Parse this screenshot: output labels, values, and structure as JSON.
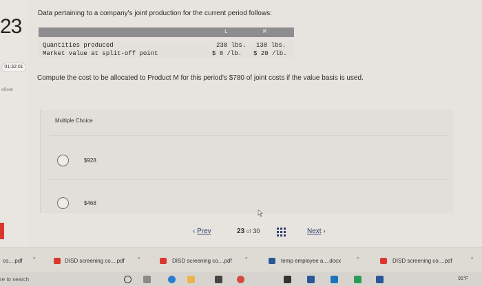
{
  "question": {
    "number": "23",
    "timer": "01:32:01",
    "ebook_label": "eBook",
    "prompt": "Data pertaining to a company's joint production for the current period follows:",
    "table": {
      "headers": [
        "L",
        "M"
      ],
      "rows": [
        {
          "label": "Quantities produced",
          "L": "230 lbs.",
          "M": "138 lbs."
        },
        {
          "label": "Market value at split-off point",
          "L": "$  8 /lb.",
          "M": "$ 20 /lb."
        }
      ]
    },
    "text": "Compute the cost to be allocated to Product M for this period's $780 of joint costs if the value basis is used."
  },
  "multiple_choice": {
    "label": "Multiple Choice",
    "options": [
      "$928",
      "$468"
    ]
  },
  "nav": {
    "prev": "Prev",
    "current": "23",
    "of": "of",
    "total": "30",
    "next": "Next"
  },
  "downloads": {
    "items": [
      "co....pdf",
      "DISD screening co....pdf",
      "DISD screening co....pdf",
      "temp employee a....docx",
      "DISD screening co....pdf"
    ]
  },
  "taskbar": {
    "search_text": "re to search",
    "temperature": "91°F"
  },
  "colors": {
    "accent": "#2c3e6b",
    "pdf_icon": "#d9382f",
    "word_icon": "#2b5797"
  }
}
